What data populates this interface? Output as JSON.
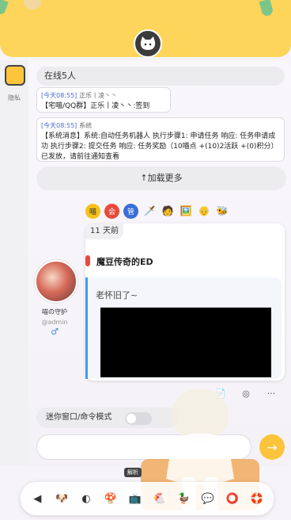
{
  "header": {
    "logo_icon": "cat-face-icon"
  },
  "leftbar": {
    "label": "隐私"
  },
  "chat": {
    "online": "在线5人",
    "messages": [
      {
        "time": "[今天08:55]",
        "meta": "正乐丨凌丶丶",
        "text": "【宅喵/QQ群】正乐丨凌丶丶:签到"
      },
      {
        "time": "[今天08:55]",
        "meta": "系统",
        "text": "【系统消息】系统:自动任务机器人 执行步骤1: 申请任务 响应: 任务申请成功 执行步骤2: 提交任务 响应: 任务奖励（10喵点 +(10)2活跃 +(0)积分）已发放，请前往通知查看"
      }
    ],
    "load_more": "↑加载更多"
  },
  "toolbar": {
    "chips": [
      "喵",
      "会",
      "管"
    ],
    "emojis": [
      "🗡️",
      "🧑",
      "🖼️",
      "👴",
      "🐝"
    ]
  },
  "post": {
    "time": "11 天前",
    "title": "魔豆传奇的ED",
    "content": "老怀旧了~",
    "user": {
      "name": "喵の守护",
      "handle": "@admin",
      "gender": "♂"
    },
    "actions": [
      "📄",
      "◎",
      "···"
    ]
  },
  "controls": {
    "mini_mode": "迷你窗口/命令模式",
    "send_icon": "→"
  },
  "dock": {
    "tooltip": "解析",
    "items": [
      "◀",
      "🐶",
      "◐",
      "🍄",
      "📺",
      "🐔",
      "🦆",
      "💬",
      "⭕",
      "🛟"
    ]
  }
}
